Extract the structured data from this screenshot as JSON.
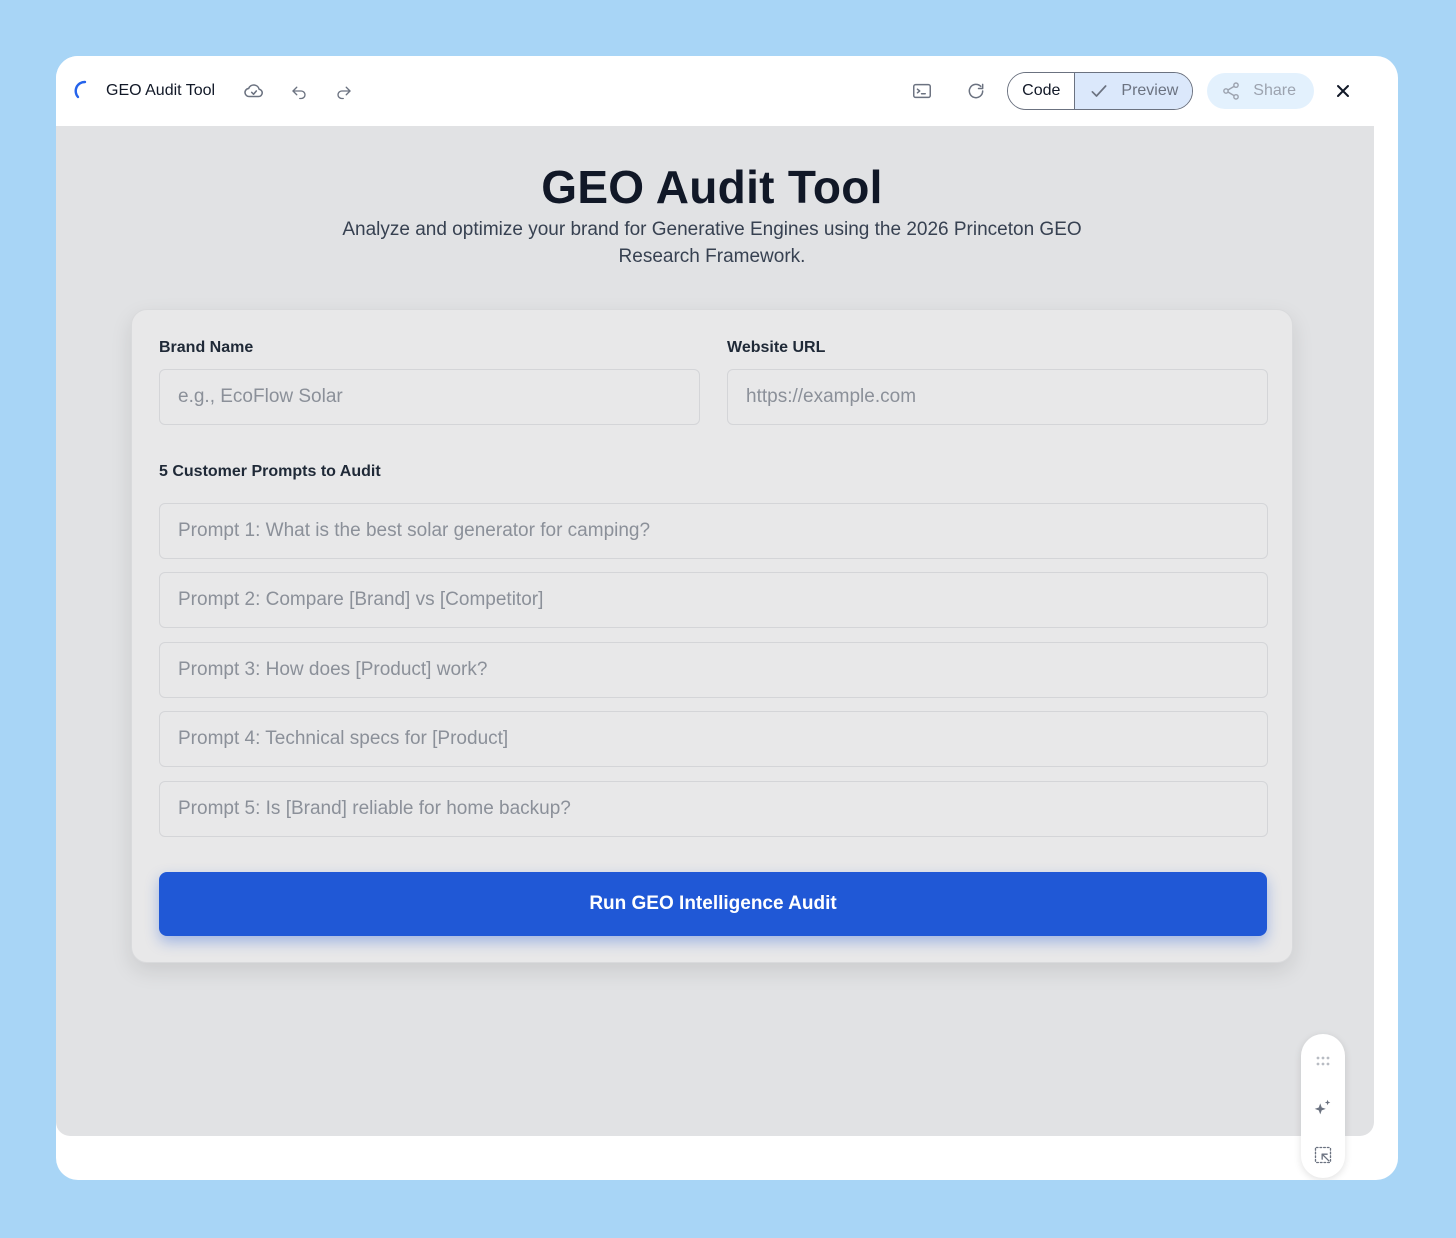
{
  "toolbar": {
    "app_title": "GEO Audit Tool",
    "icons": [
      "loading-spinner-icon",
      "cloud-icon",
      "undo-icon",
      "redo-icon",
      "terminal-icon",
      "refresh-icon",
      "check-icon",
      "share-icon",
      "close-icon"
    ],
    "code_label": "Code",
    "preview_label": "Preview",
    "share_label": "Share"
  },
  "page": {
    "title": "GEO Audit Tool",
    "subtitle": "Analyze and optimize your brand for Generative Engines using the 2026 Princeton GEO Research Framework."
  },
  "form": {
    "brand_label": "Brand Name",
    "brand_placeholder": "e.g., EcoFlow Solar",
    "url_label": "Website URL",
    "url_placeholder": "https://example.com",
    "prompts_label": "5 Customer Prompts to Audit",
    "prompts": [
      {
        "placeholder": "Prompt 1: What is the best solar generator for camping?"
      },
      {
        "placeholder": "Prompt 2: Compare [Brand] vs [Competitor]"
      },
      {
        "placeholder": "Prompt 3: How does [Product] work?"
      },
      {
        "placeholder": "Prompt 4: Technical specs for [Product]"
      },
      {
        "placeholder": "Prompt 5: Is [Brand] reliable for home backup?"
      }
    ],
    "submit_label": "Run GEO Intelligence Audit"
  },
  "floating_toolbar": {
    "icons": [
      "drag-handle-icon",
      "sparkle-icon",
      "select-element-icon"
    ]
  },
  "colors": {
    "background": "#a8d5f6",
    "accent": "#2058d6",
    "preview_bg": "#e1e2e4"
  }
}
